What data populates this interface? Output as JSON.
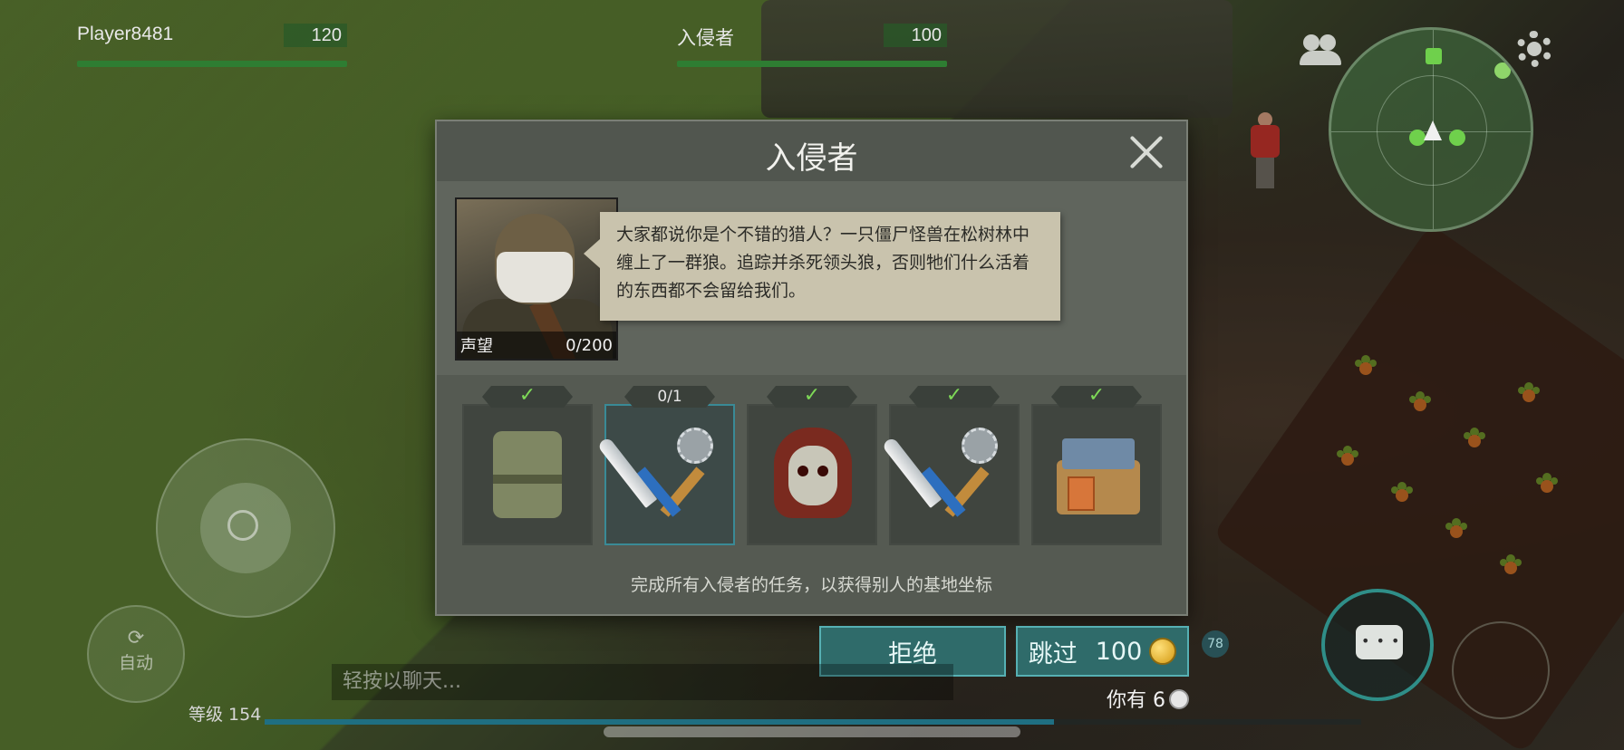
{
  "player": {
    "name": "Player8481",
    "hp": "120",
    "hp_fraction": 1.0
  },
  "enemy": {
    "name": "入侵者",
    "hp": "100",
    "hp_fraction": 1.0
  },
  "dialog": {
    "title": "入侵者",
    "story": "大家都说你是个不错的猎人？一只僵尸怪兽在松树林中缠上了一群狼。追踪并杀死领头狼，否则牠们什么活着的东西都不会留给我们。",
    "reputation_label": "声望",
    "reputation_value": "0/200",
    "tasks": [
      {
        "icon": "military-vest-icon",
        "status": "✓",
        "done": true
      },
      {
        "icon": "machete-saw-weapons-icon",
        "status": "0/1",
        "done": false
      },
      {
        "icon": "zombie-head-icon",
        "status": "✓",
        "done": true
      },
      {
        "icon": "machete-saw-weapons-icon",
        "status": "✓",
        "done": true
      },
      {
        "icon": "workbench-icon",
        "status": "✓",
        "done": true
      }
    ],
    "note": "完成所有入侵者的任务，以获得别人的基地坐标"
  },
  "buttons": {
    "reject": "拒绝",
    "skip": "跳过",
    "skip_cost": "100"
  },
  "currency": {
    "owned_label": "你有 6"
  },
  "hud": {
    "auto_label": "自动",
    "chat_placeholder": "轻按以聊天...",
    "level_label": "等级 154",
    "xp_fraction": 0.72,
    "notification_count": "78"
  },
  "colors": {
    "accent": "#2f6b6a",
    "hp_green": "#2e7d32",
    "check_green": "#7ed957"
  }
}
